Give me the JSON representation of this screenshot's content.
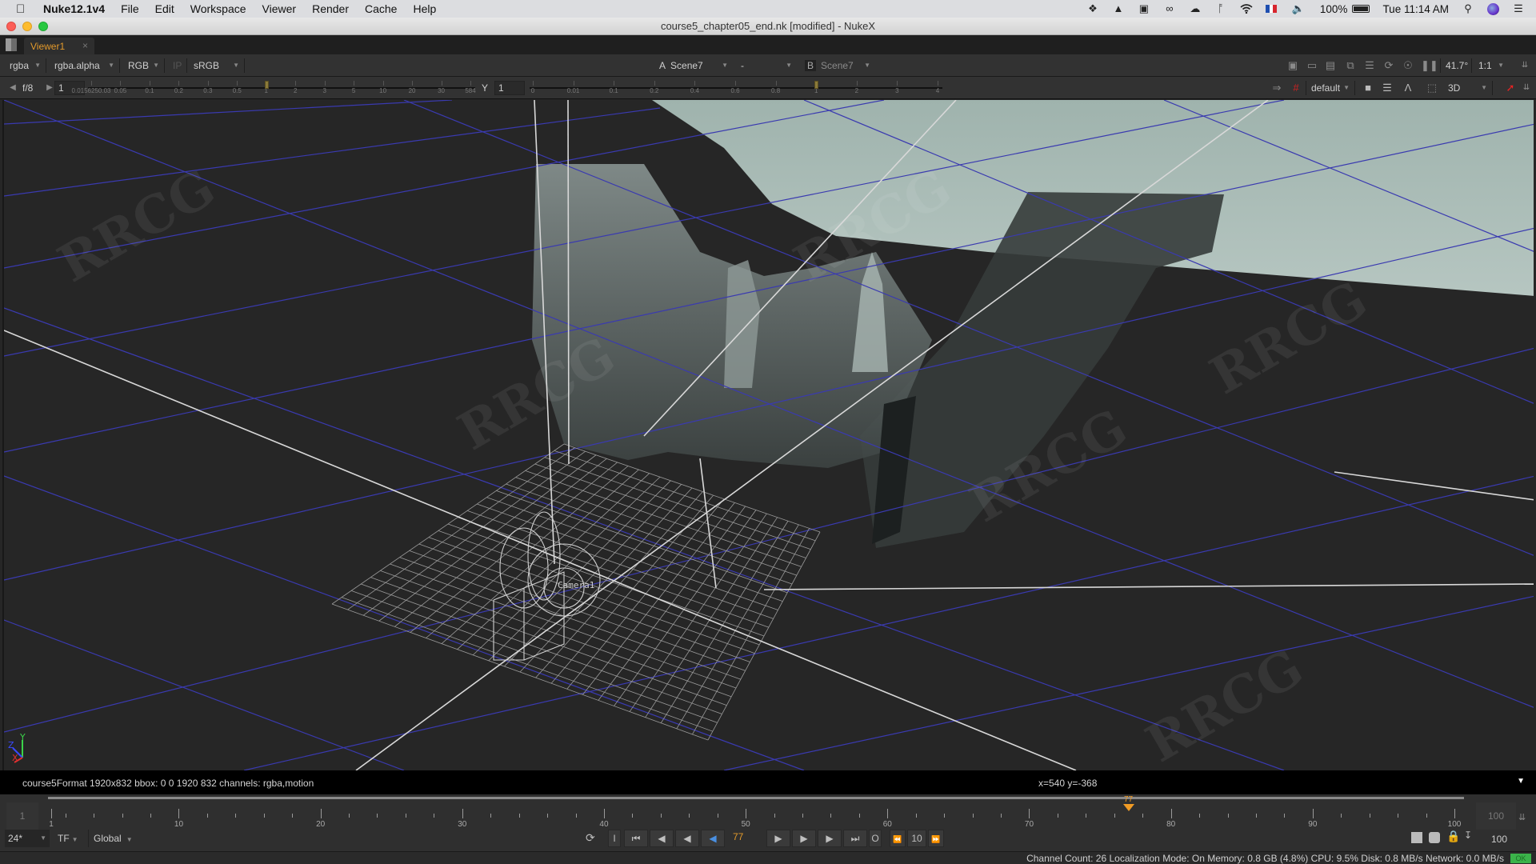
{
  "menubar": {
    "app_name": "Nuke12.1v4",
    "items": [
      "File",
      "Edit",
      "Workspace",
      "Viewer",
      "Render",
      "Cache",
      "Help"
    ],
    "tray": {
      "battery": "100%",
      "clock": "Tue 11:14 AM",
      "icons": [
        "dropbox-icon",
        "flask-icon",
        "display-icon",
        "creative-cloud-icon",
        "cloud-upload-icon",
        "bluetooth-icon",
        "wifi-icon",
        "flag-fr-icon",
        "volume-icon",
        "battery-icon",
        "spotlight-icon",
        "siri-icon",
        "notification-center-icon"
      ]
    }
  },
  "window": {
    "title": "course5_chapter05_end.nk [modified] - NukeX"
  },
  "tabs": [
    {
      "label": "Viewer1",
      "close": "×"
    }
  ],
  "viewer_toolbar": {
    "channels": "rgba",
    "alpha_channel": "rgba.alpha",
    "display_channels": "RGB",
    "ip_label": "IP",
    "lut": "sRGB",
    "input_a_label": "A",
    "input_a": "Scene7",
    "composite_op": "-",
    "input_b_label": "B",
    "input_b": "Scene7",
    "zoom_value": "41.7°",
    "proxy_ratio": "1:1"
  },
  "viewer_toolbar2": {
    "fstop": "f/8",
    "gain_value": "1",
    "gain_ticks": [
      "0.0156250.03",
      "0.05",
      "0.1",
      "0.2",
      "0.3",
      "0.5",
      "1",
      "2",
      "3",
      "5",
      "10",
      "20",
      "30",
      "584"
    ],
    "gamma_label": "Y",
    "gamma_value": "1",
    "gamma_ticks": [
      "0",
      "0.01",
      "0.1",
      "0.2",
      "0.4",
      "0.6",
      "0.8",
      "1",
      "2",
      "3",
      "4"
    ],
    "gain_position": 1,
    "gamma_position": 1,
    "overlay_mode": "default",
    "view_mode": "3D"
  },
  "viewport": {
    "camera_label": "Camera1",
    "axis_labels": {
      "x": "X",
      "y": "Y",
      "z": "Z"
    }
  },
  "infobar": {
    "format_info": "course5Format 1920x832  bbox: 0 0 1920 832 channels: rgba,motion",
    "cursor_coords": "x=540 y=-368"
  },
  "timeline": {
    "start_frame": "1",
    "end_frame": "100",
    "current_frame": 77,
    "current_frame_label": "77",
    "range": [
      1,
      100
    ],
    "tick_labels": [
      "1",
      "10",
      "20",
      "30",
      "40",
      "50",
      "60",
      "70",
      "80",
      "90",
      "100"
    ],
    "fps": "24*",
    "time_format": "TF",
    "range_mode": "Global",
    "in_label": "I",
    "out_label": "O",
    "frame_current_display": "77",
    "step_value": "10",
    "out_point_value": "100"
  },
  "statusbar": {
    "text": "Channel Count: 26 Localization Mode: On Memory: 0.8 GB (4.8%) CPU: 9.5% Disk: 0.8 MB/s Network: 0.0 MB/s",
    "ok_label": "OK"
  },
  "colors": {
    "accent_orange": "#e39a2b",
    "playhead": "#f09b25",
    "grid_blue": "#3a3ab0",
    "ok_green": "#3bb34a"
  }
}
